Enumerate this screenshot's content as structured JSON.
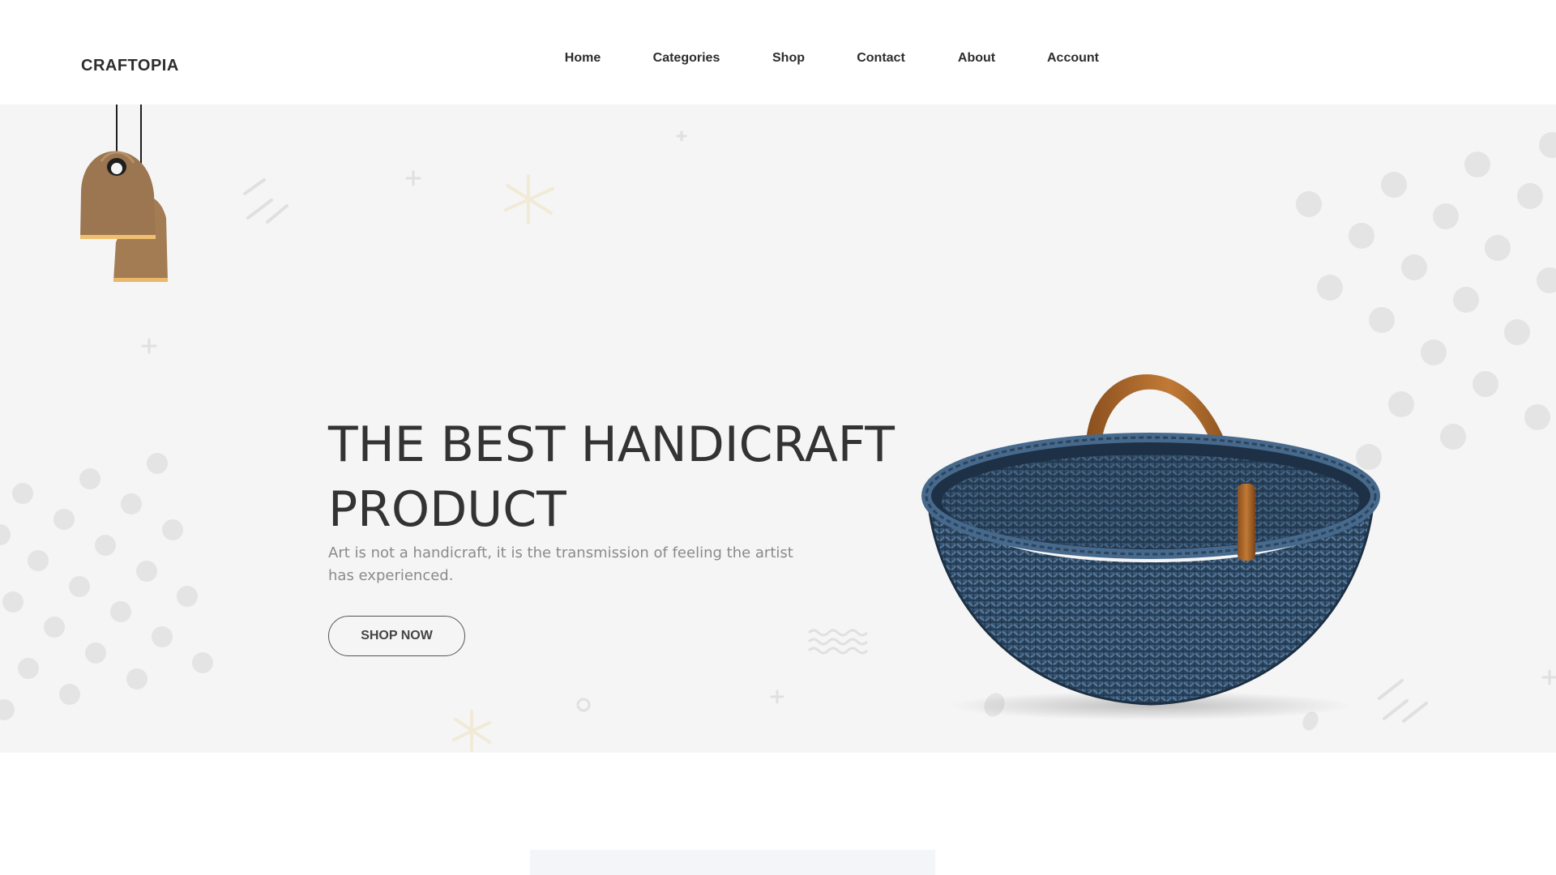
{
  "brand": {
    "name": "CRAFTOPIA"
  },
  "nav": {
    "items": [
      {
        "label": "Home"
      },
      {
        "label": "Categories"
      },
      {
        "label": "Shop"
      },
      {
        "label": "Contact"
      },
      {
        "label": "About"
      },
      {
        "label": "Account"
      }
    ]
  },
  "hero": {
    "title": "THE BEST HANDICRAFT PRODUCT",
    "subtitle": "Art is not a handicraft, it is the transmission of feeling the artist has experienced.",
    "cta_label": "SHOP NOW",
    "product_image": "woven-basket-image",
    "decor_image": "pendant-lamps-image"
  },
  "colors": {
    "hero_background": "#f5f5f5",
    "text_dark": "#333333",
    "text_muted": "#8a8a8a",
    "basket_blue": "#2e4a66",
    "handle_wood": "#a0622a",
    "lamp_wood": "#9c7a56"
  }
}
